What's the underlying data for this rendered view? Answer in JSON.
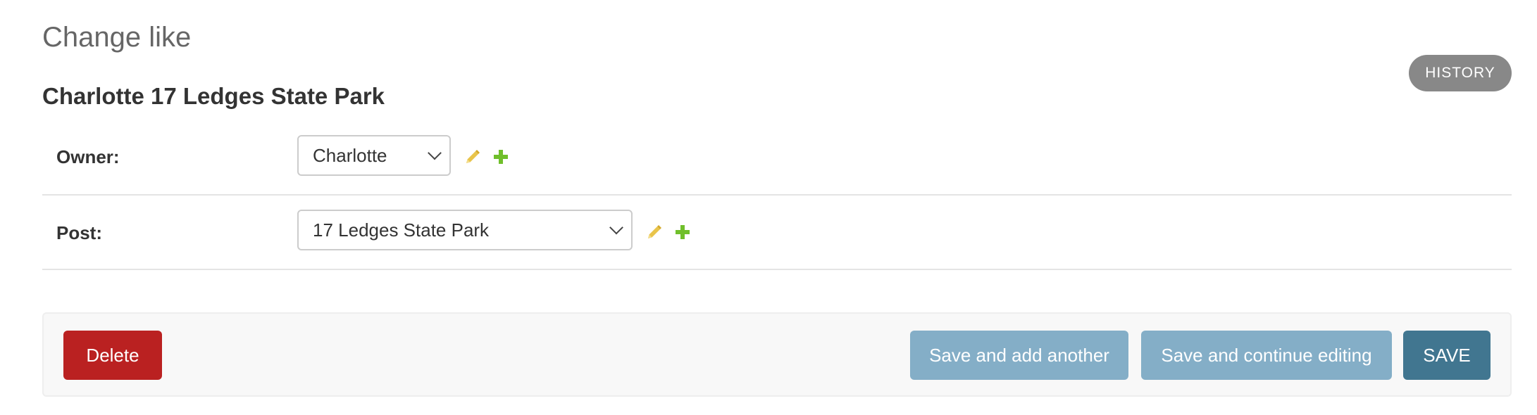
{
  "page": {
    "title": "Change like",
    "object_title": "Charlotte 17 Ledges State Park",
    "history_label": "HISTORY"
  },
  "form": {
    "owner": {
      "label": "Owner:",
      "value": "Charlotte",
      "icons": [
        "pencil-icon",
        "plus-icon"
      ]
    },
    "post": {
      "label": "Post:",
      "value": "17 Ledges State Park",
      "icons": [
        "pencil-icon",
        "plus-icon"
      ]
    }
  },
  "actions": {
    "delete_label": "Delete",
    "save_add_another_label": "Save and add another",
    "save_continue_label": "Save and continue editing",
    "save_label": "SAVE"
  },
  "colors": {
    "delete": "#ba2121",
    "secondary_button": "#84aec7",
    "primary_button": "#417690",
    "history_button": "#888888",
    "change_icon": "#e9c44a",
    "add_icon": "#70bf2b"
  }
}
